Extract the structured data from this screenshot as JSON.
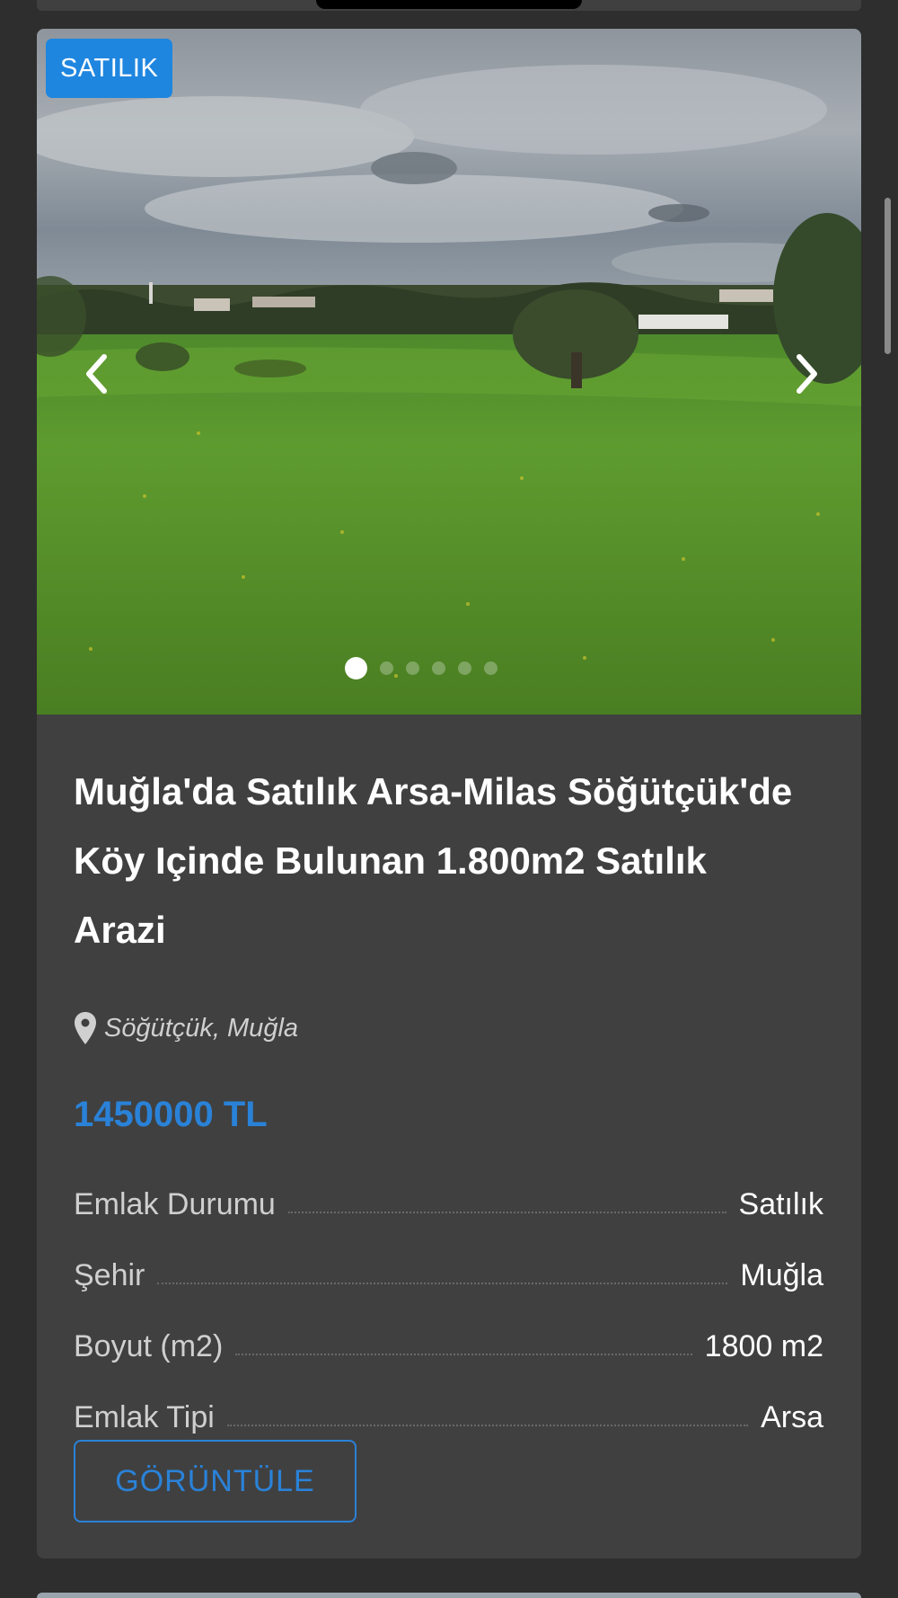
{
  "listing": {
    "badge": "SATILIK",
    "title": "Muğla'da Satılık Arsa-Milas Söğütçük'de Köy Içinde Bulunan 1.800m2 Satılık Arazi",
    "location": "Söğütçük, Muğla",
    "price": "1450000 TL",
    "specs": [
      {
        "label": "Emlak Durumu",
        "value": "Satılık"
      },
      {
        "label": "Şehir",
        "value": "Muğla"
      },
      {
        "label": "Boyut (m2)",
        "value": "1800 m2"
      },
      {
        "label": "Emlak Tipi",
        "value": "Arsa"
      }
    ],
    "view_button": "GÖRÜNTÜLE"
  },
  "gallery": {
    "image_count": 6,
    "active_index": 0,
    "icons": {
      "prev": "chevron-left-icon",
      "next": "chevron-right-icon",
      "location": "map-pin-icon"
    }
  },
  "colors": {
    "background": "#2e2e2e",
    "card": "#404040",
    "accent": "#2a82d8",
    "badge": "#1f86e0"
  }
}
